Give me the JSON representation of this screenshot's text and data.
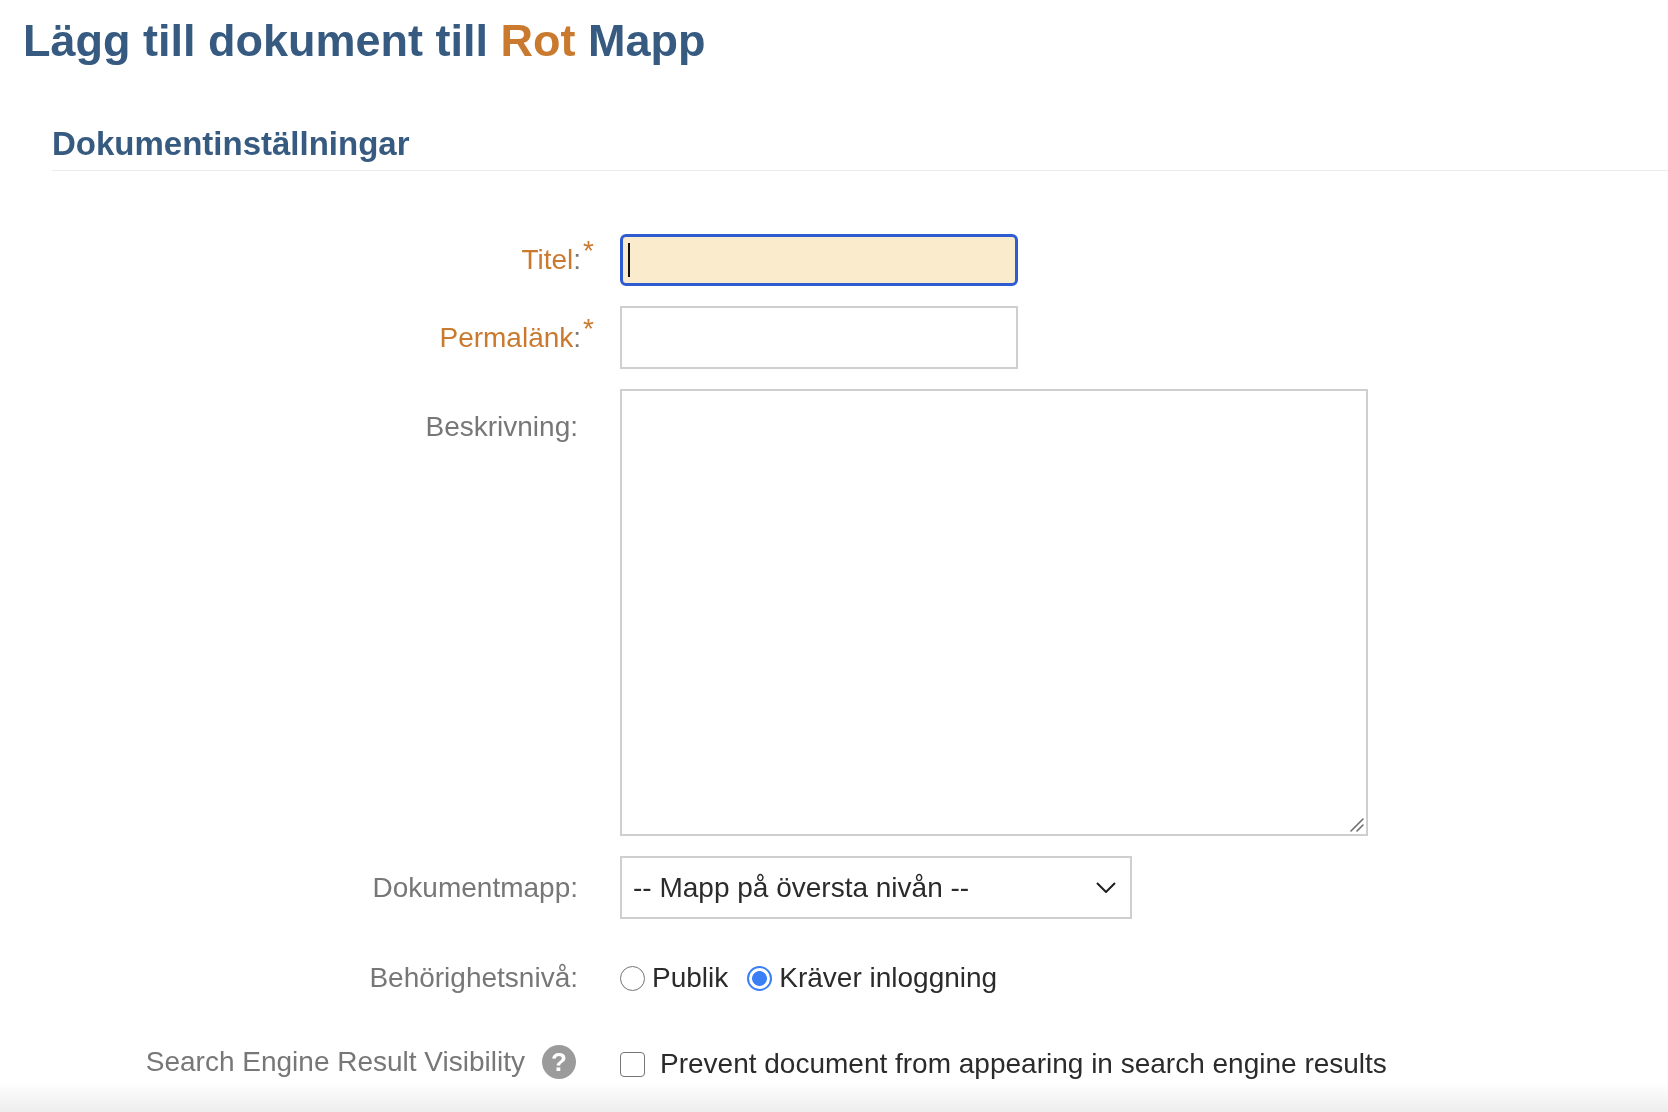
{
  "page_title": {
    "prefix": "Lägg till dokument till",
    "folder": "Rot",
    "suffix": "Mapp"
  },
  "section": {
    "heading": "Dokumentinställningar",
    "fields": [
      {
        "kind": "text",
        "label": "Titel",
        "separator": ":",
        "required": true,
        "required_mark": "*",
        "focused": true
      },
      {
        "kind": "text",
        "label": "Permalänk",
        "separator": ":",
        "required": true,
        "required_mark": "*",
        "focused": false
      },
      {
        "kind": "textarea",
        "label": "Beskrivning",
        "separator": ":",
        "required": false
      },
      {
        "kind": "select",
        "label": "Dokumentmapp",
        "separator": ":",
        "required": false,
        "value": "-- Mapp på översta nivån --"
      },
      {
        "kind": "radio",
        "label": "Behörighetsnivå",
        "separator": ":",
        "required": false,
        "options": [
          {
            "label": "Publik",
            "selected": false
          },
          {
            "label": "Kräver inloggning",
            "selected": true
          }
        ]
      },
      {
        "kind": "checkbox",
        "label": "Search Engine Result Visibility",
        "required": false,
        "help": "?",
        "option": {
          "label": "Prevent document from appearing in search engine results",
          "checked": false
        }
      }
    ]
  }
}
